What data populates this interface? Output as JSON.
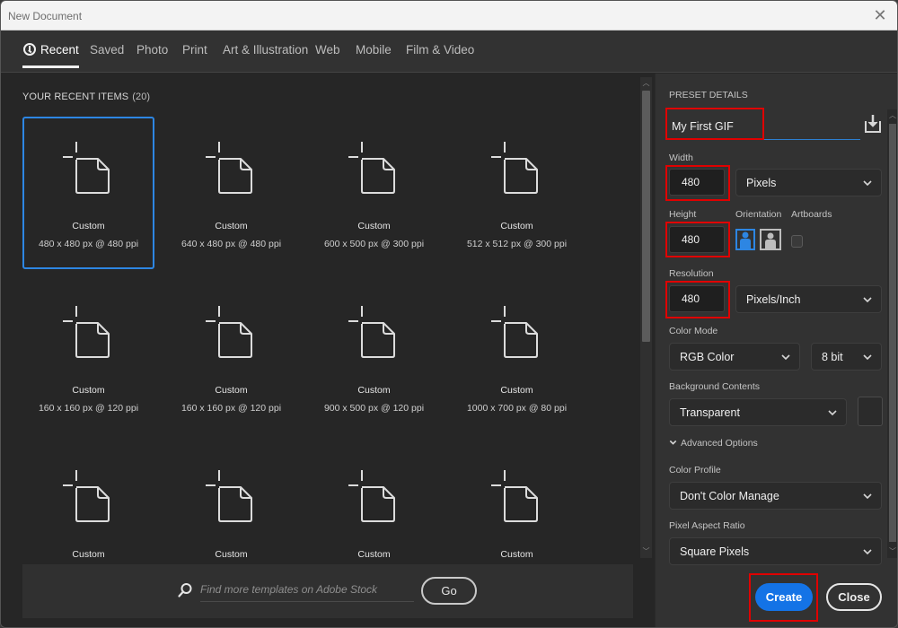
{
  "window": {
    "title": "New Document",
    "close_icon": "close-icon"
  },
  "tabs": [
    {
      "label": "Recent",
      "icon": "clock-icon",
      "active": true
    },
    {
      "label": "Saved"
    },
    {
      "label": "Photo"
    },
    {
      "label": "Print"
    },
    {
      "label": "Art & Illustration"
    },
    {
      "label": "Web"
    },
    {
      "label": "Mobile"
    },
    {
      "label": "Film & Video"
    }
  ],
  "recent": {
    "heading": "YOUR RECENT ITEMS",
    "count": "(20)",
    "items": [
      {
        "name": "Custom",
        "dims": "480 x 480 px @ 480 ppi",
        "selected": true
      },
      {
        "name": "Custom",
        "dims": "640 x 480 px @ 480 ppi"
      },
      {
        "name": "Custom",
        "dims": "600 x 500 px @ 300 ppi"
      },
      {
        "name": "Custom",
        "dims": "512 x 512 px @ 300 ppi"
      },
      {
        "name": "Custom",
        "dims": "160 x 160 px @ 120 ppi"
      },
      {
        "name": "Custom",
        "dims": "160 x 160 px @ 120 ppi"
      },
      {
        "name": "Custom",
        "dims": "900 x 500 px @ 120 ppi"
      },
      {
        "name": "Custom",
        "dims": "1000 x 700 px @ 80 ppi"
      },
      {
        "name": "Custom",
        "dims": ""
      },
      {
        "name": "Custom",
        "dims": ""
      },
      {
        "name": "Custom",
        "dims": ""
      },
      {
        "name": "Custom",
        "dims": ""
      }
    ]
  },
  "stock": {
    "placeholder": "Find more templates on Adobe Stock",
    "go_label": "Go"
  },
  "preset": {
    "heading": "PRESET DETAILS",
    "name_value": "My First GIF",
    "save_icon": "save-preset-icon",
    "width_label": "Width",
    "width_value": "480",
    "width_unit": "Pixels",
    "height_label": "Height",
    "height_value": "480",
    "orientation_label": "Orientation",
    "orientation_selected": "portrait",
    "artboards_label": "Artboards",
    "artboards_checked": false,
    "resolution_label": "Resolution",
    "resolution_value": "480",
    "resolution_unit": "Pixels/Inch",
    "color_mode_label": "Color Mode",
    "color_mode": "RGB Color",
    "bit_depth": "8 bit",
    "background_label": "Background Contents",
    "background": "Transparent",
    "advanced_label": "Advanced Options",
    "color_profile_label": "Color Profile",
    "color_profile": "Don't Color Manage",
    "pixel_aspect_label": "Pixel Aspect Ratio",
    "pixel_aspect": "Square Pixels"
  },
  "actions": {
    "create_label": "Create",
    "close_label": "Close"
  },
  "colors": {
    "accent": "#1473e6",
    "selection": "#2d86e3",
    "highlight_annotation": "#e00000"
  }
}
